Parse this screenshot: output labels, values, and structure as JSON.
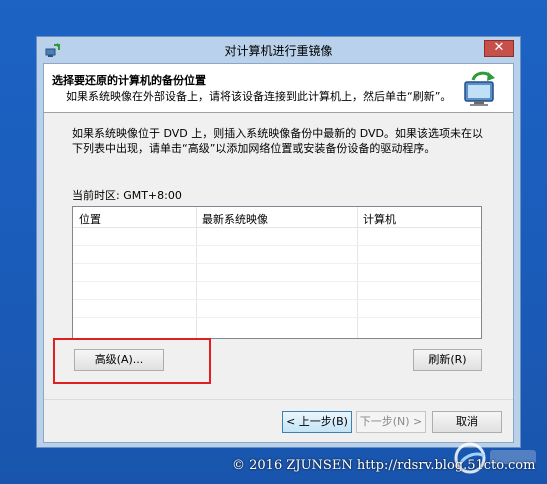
{
  "window": {
    "title": "对计算机进行重镜像",
    "close_label": "✕"
  },
  "header": {
    "title": "选择要还原的计算机的备份位置",
    "subtitle": "如果系统映像在外部设备上，请将该设备连接到此计算机上，然后单击“刷新”。"
  },
  "description": "如果系统映像位于 DVD 上，则插入系统映像备份中最新的 DVD。如果该选项未在以下列表中出现，请单击“高级”以添加网络位置或安装备份设备的驱动程序。",
  "timezone": "当前时区: GMT+8:00",
  "table": {
    "columns": [
      "位置",
      "最新系统映像",
      "计算机"
    ],
    "rows": []
  },
  "buttons": {
    "advanced": "高级(A)...",
    "refresh": "刷新(R)",
    "back": "< 上一步(B)",
    "next": "下一步(N) >",
    "cancel": "取消"
  },
  "watermark": {
    "text": "© 2016 ZJUNSEN http://rdsrv.blog.51cto.com"
  },
  "colors": {
    "desktop": "#1a5bb8",
    "window_frame": "#b9d1ea",
    "close_button": "#c7504b",
    "highlight_box": "#e02020"
  },
  "icons": [
    "app-icon",
    "computer-restore-icon",
    "close-icon",
    "site-logo-icon"
  ]
}
